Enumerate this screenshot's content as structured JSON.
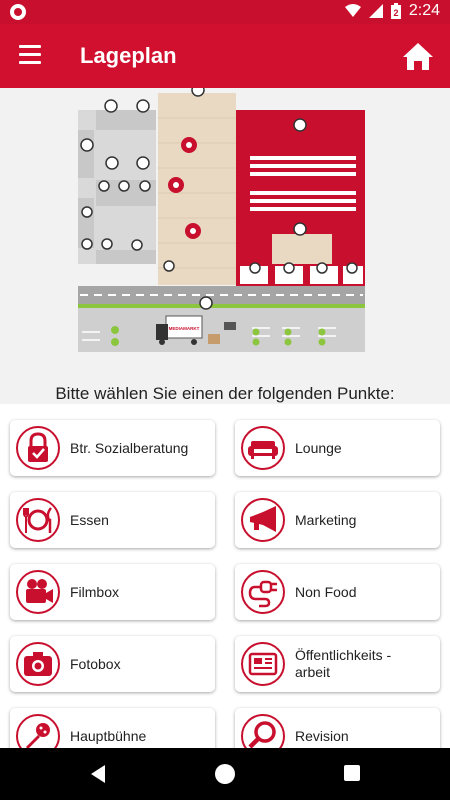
{
  "statusbar": {
    "time": "2:24",
    "battery_level": "2"
  },
  "appbar": {
    "title": "Lageplan"
  },
  "prompt": "Bitte wählen Sie einen der folgenden Punkte:",
  "map": {
    "truck_label": "MEDIAMARKT"
  },
  "colors": {
    "accent": "#c8102e",
    "appbar": "#d0102e"
  },
  "items": [
    {
      "label": "Btr. Sozialberatung",
      "icon": "lock-icon"
    },
    {
      "label": "Lounge",
      "icon": "sofa-icon"
    },
    {
      "label": "Essen",
      "icon": "cutlery-icon"
    },
    {
      "label": "Marketing",
      "icon": "megaphone-icon"
    },
    {
      "label": "Filmbox",
      "icon": "camera-icon"
    },
    {
      "label": "Non Food",
      "icon": "plug-icon"
    },
    {
      "label": "Fotobox",
      "icon": "photo-camera-icon"
    },
    {
      "label": "Öffentlichkeits -\narbeit",
      "icon": "newspaper-icon"
    },
    {
      "label": "Hauptbühne",
      "icon": "microphone-icon"
    },
    {
      "label": "Revision",
      "icon": "magnifier-icon"
    }
  ]
}
